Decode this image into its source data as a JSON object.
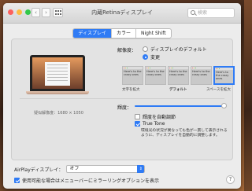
{
  "window": {
    "title": "内蔵Retinaディスプレイ",
    "search_placeholder": "検索"
  },
  "tabs": [
    {
      "label": "ディスプレイ",
      "active": true
    },
    {
      "label": "カラー",
      "active": false
    },
    {
      "label": "Night Shift",
      "active": false
    }
  ],
  "display": {
    "resolution_note": "疑似解像度：1680 × 1050",
    "resolution_label": "解像度：",
    "option_default": "ディスプレイのデフォルト",
    "option_scaled": "変更",
    "thumb_text": "Here's to the crazy ones",
    "scale_captions": [
      "文字を拡大",
      "デフォルト",
      "スペースを拡大"
    ],
    "brightness_label": "輝度：",
    "brightness_level": 1.0,
    "auto_brightness_label": "輝度を自動調節",
    "true_tone_label": "True Tone",
    "true_tone_desc": "環境光の状況が異なっても色が一貫して表示されるように、ディスプレイを自動的に調整します。"
  },
  "airplay": {
    "label": "AirPlayディスプレイ：",
    "value": "オフ"
  },
  "mirror_label": "使用可能な場合はメニューバーにミラーリングオプションを表示",
  "help": "?",
  "colors": {
    "accent": "#2f7bf5"
  }
}
